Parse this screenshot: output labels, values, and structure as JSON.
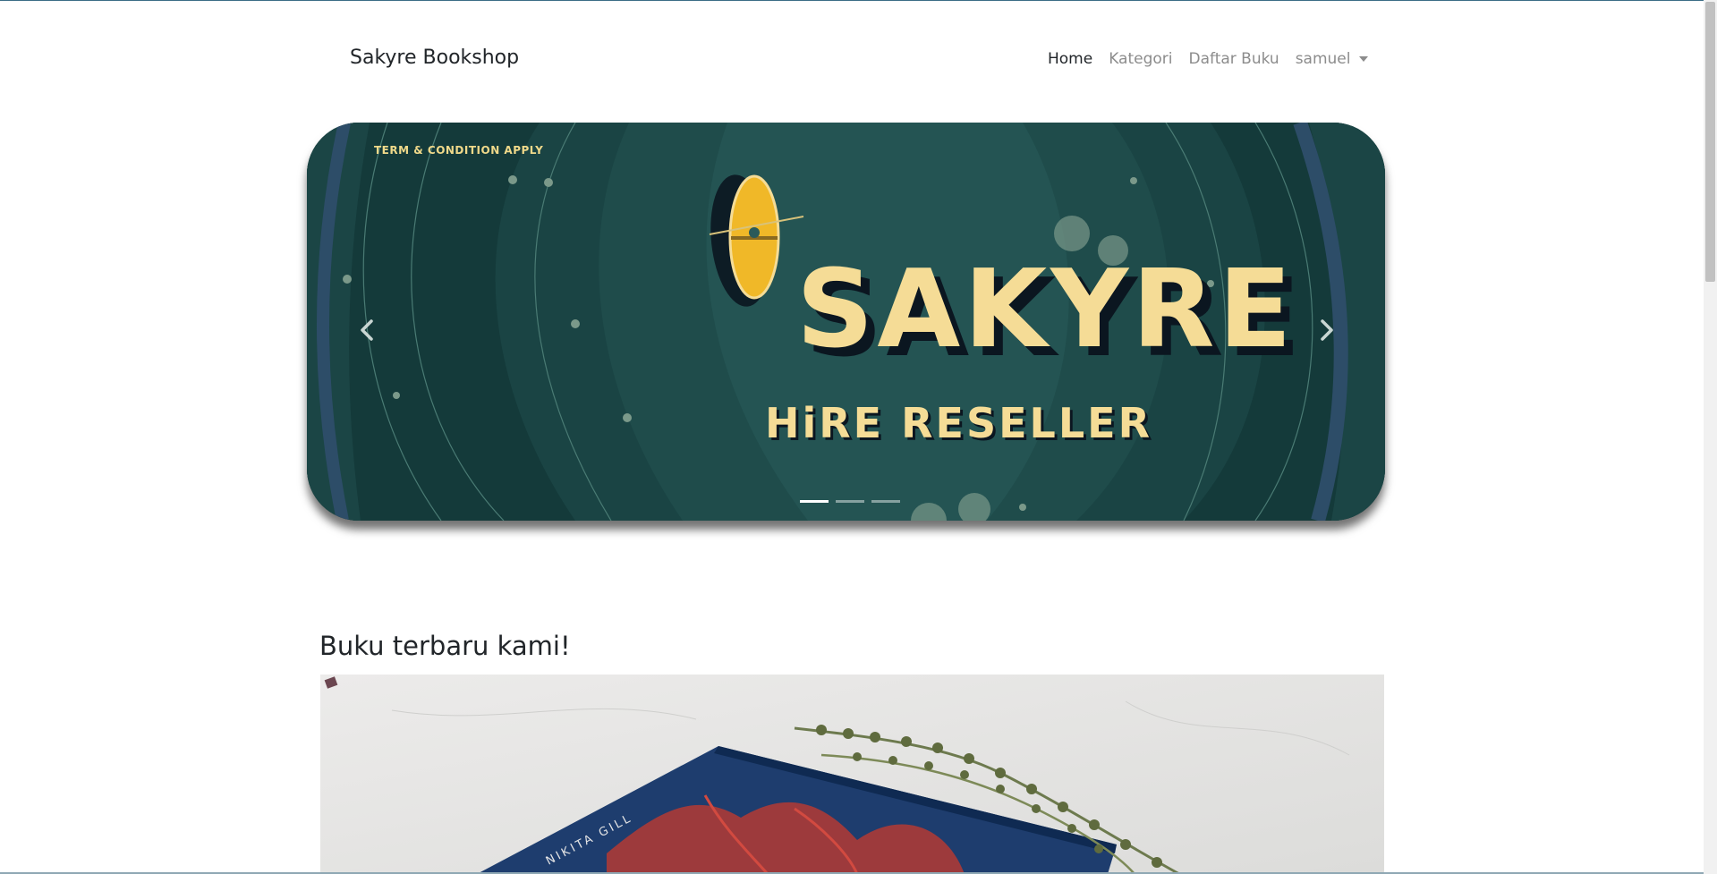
{
  "navbar": {
    "brand": "Sakyre Bookshop",
    "links": [
      "Home",
      "Kategori",
      "Daftar Buku"
    ],
    "active_link": "Home",
    "user_menu": "samuel"
  },
  "carousel": {
    "slide_caption_small": "TERM & CONDITION APPLY",
    "slide_title": "SAKYRE",
    "slide_subtitle": "HiRE RESELLER",
    "slide_count": 3,
    "active_slide": 1,
    "colors": {
      "background": "#143a3a",
      "accent": "#f5dc96",
      "boat": "#f0b828"
    }
  },
  "section": {
    "title": "Buku terbaru kami!",
    "photo_text": {
      "author": "NIKITA GILL"
    }
  },
  "icons": {
    "prev": "chevron-left-icon",
    "next": "chevron-right-icon",
    "dropdown": "caret-down-icon"
  }
}
